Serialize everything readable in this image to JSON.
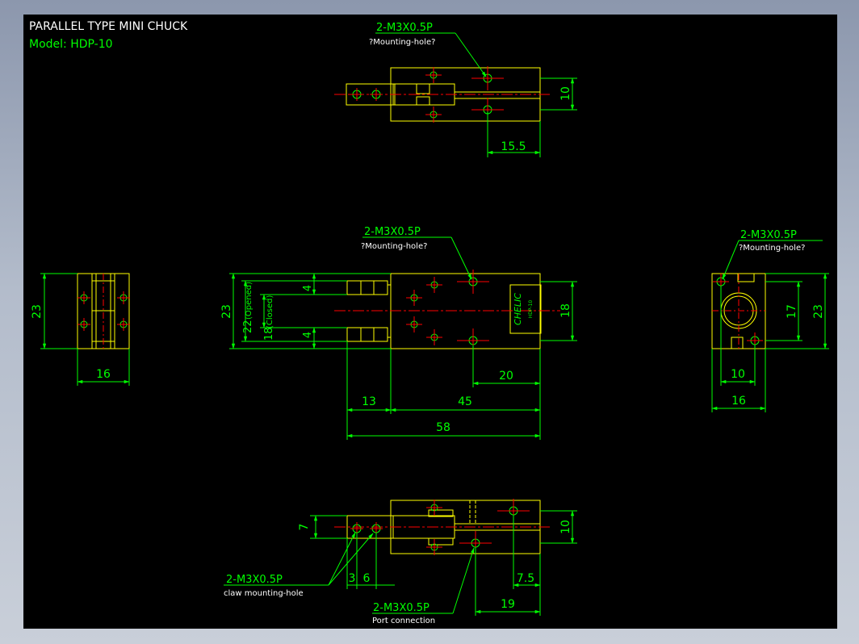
{
  "header": {
    "title": "PARALLEL TYPE MINI CHUCK",
    "model": "Model:  HDP-10"
  },
  "colors": {
    "background": "#000000",
    "outline": "#ffff00",
    "dimension": "#00ff00",
    "centerline": "#ff0000",
    "text": "#ffffff"
  },
  "callouts": {
    "top_mount": {
      "spec": "2-M3X0.5P",
      "note": "?Mounting-hole?"
    },
    "front_mount": {
      "spec": "2-M3X0.5P",
      "note": "?Mounting-hole?"
    },
    "right_mount": {
      "spec": "2-M3X0.5P",
      "note": "?Mounting-hole?"
    },
    "claw_mount": {
      "spec": "2-M3X0.5P",
      "note": "claw mounting-hole"
    },
    "port": {
      "spec": "2-M3X0.5P",
      "note": "Port connection"
    }
  },
  "dims": {
    "top_10": "10",
    "top_15_5": "15.5",
    "left_23": "23",
    "left_16": "16",
    "front_23": "23",
    "front_22": "22",
    "front_18_closed": "18",
    "opened_label": "(Opened)",
    "closed_label": "(Closed)",
    "front_4a": "4",
    "front_4b": "4",
    "front_18": "18",
    "front_20": "20",
    "front_13": "13",
    "front_45": "45",
    "front_58": "58",
    "right_23": "23",
    "right_17": "17",
    "right_10": "10",
    "right_16": "16",
    "bottom_7": "7",
    "bottom_10": "10",
    "bottom_3": "3",
    "bottom_6": "6",
    "bottom_7_5": "7.5",
    "bottom_19": "19"
  },
  "label_plate": {
    "brand": "CHELIC",
    "model": "HDP-10"
  }
}
